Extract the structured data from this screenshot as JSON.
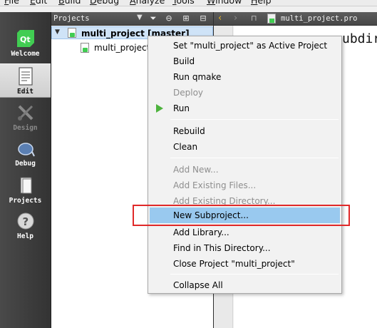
{
  "menubar": {
    "items": [
      "File",
      "Edit",
      "Build",
      "Debug",
      "Analyze",
      "Tools",
      "Window",
      "Help"
    ]
  },
  "modebar": {
    "items": [
      {
        "label": "Welcome",
        "icon": "qt-logo-icon",
        "state": "normal"
      },
      {
        "label": "Edit",
        "icon": "document-edit-icon",
        "state": "active"
      },
      {
        "label": "Design",
        "icon": "design-tools-icon",
        "state": "disabled"
      },
      {
        "label": "Debug",
        "icon": "bug-icon",
        "state": "normal"
      },
      {
        "label": "Projects",
        "icon": "projects-icon",
        "state": "normal"
      },
      {
        "label": "Help",
        "icon": "help-icon",
        "state": "normal"
      }
    ]
  },
  "projects_pane": {
    "title": "Projects",
    "toolbar_icons": [
      "filter-icon",
      "link-icon",
      "split-icon",
      "close-pane-icon"
    ]
  },
  "tree": {
    "root_label": "multi_project [master]",
    "child_label": "multi_project"
  },
  "editor": {
    "file_name": "multi_project.pro",
    "code_fragment": "ubdir"
  },
  "context_menu": {
    "items": [
      {
        "label": "Set \"multi_project\" as Active Project",
        "enabled": true
      },
      {
        "label": "Build",
        "enabled": true
      },
      {
        "label": "Run qmake",
        "enabled": true
      },
      {
        "label": "Deploy",
        "enabled": false
      },
      {
        "label": "Run",
        "enabled": true,
        "icon": "run-icon"
      },
      {
        "label": "Rebuild",
        "enabled": true
      },
      {
        "label": "Clean",
        "enabled": true
      },
      {
        "label": "Add New...",
        "enabled": false
      },
      {
        "label": "Add Existing Files...",
        "enabled": false
      },
      {
        "label": "Add Existing Directory...",
        "enabled": false
      },
      {
        "label": "New Subproject...",
        "enabled": true,
        "highlighted": true
      },
      {
        "label": "Add Library...",
        "enabled": true
      },
      {
        "label": "Find in This Directory...",
        "enabled": true
      },
      {
        "label": "Close Project \"multi_project\"",
        "enabled": true
      },
      {
        "label": "Collapse All",
        "enabled": true
      }
    ]
  },
  "colors": {
    "highlight": "#99c9ef",
    "annotation_box": "#e02929",
    "run_icon": "#4db33d",
    "qt_green": "#41cd52"
  }
}
